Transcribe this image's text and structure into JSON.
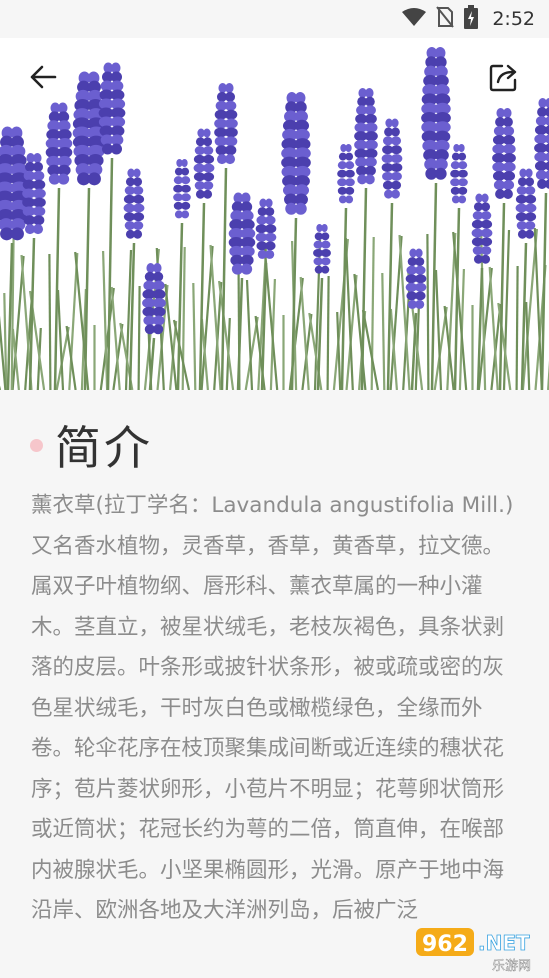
{
  "status_bar": {
    "time": "2:52",
    "icons": [
      "wifi-icon",
      "no-sim-icon",
      "battery-charging-icon"
    ]
  },
  "toolbar": {
    "back_icon": "arrow-left-icon",
    "share_icon": "share-icon"
  },
  "hero": {
    "image": "lavender-photo",
    "colors": {
      "flower": "#4b3fae",
      "stem": "#6f8f5a",
      "background": "#ffffff"
    }
  },
  "section": {
    "title": "简介",
    "dot_color": "#f6c6cb",
    "text": "薰衣草(拉丁学名：Lavandula angustifolia Mill.)又名香水植物，灵香草，香草，黄香草，拉文德。属双子叶植物纲、唇形科、薰衣草属的一种小灌木。茎直立，被星状绒毛，老枝灰褐色，具条状剥落的皮层。叶条形或披针状条形，被或疏或密的灰色星状绒毛，干时灰白色或橄榄绿色，全缘而外卷。轮伞花序在枝顶聚集成间断或近连续的穗状花序；苞片菱状卵形，小苞片不明显；花萼卵状筒形或近筒状；花冠长约为萼的二倍，筒直伸，在喉部内被腺状毛。小坚果椭圆形，光滑。原产于地中海沿岸、欧洲各地及大洋洲列岛，后被广泛"
  },
  "watermark": {
    "brand": "962",
    "suffix": ".NET",
    "subtitle": "乐游网"
  }
}
